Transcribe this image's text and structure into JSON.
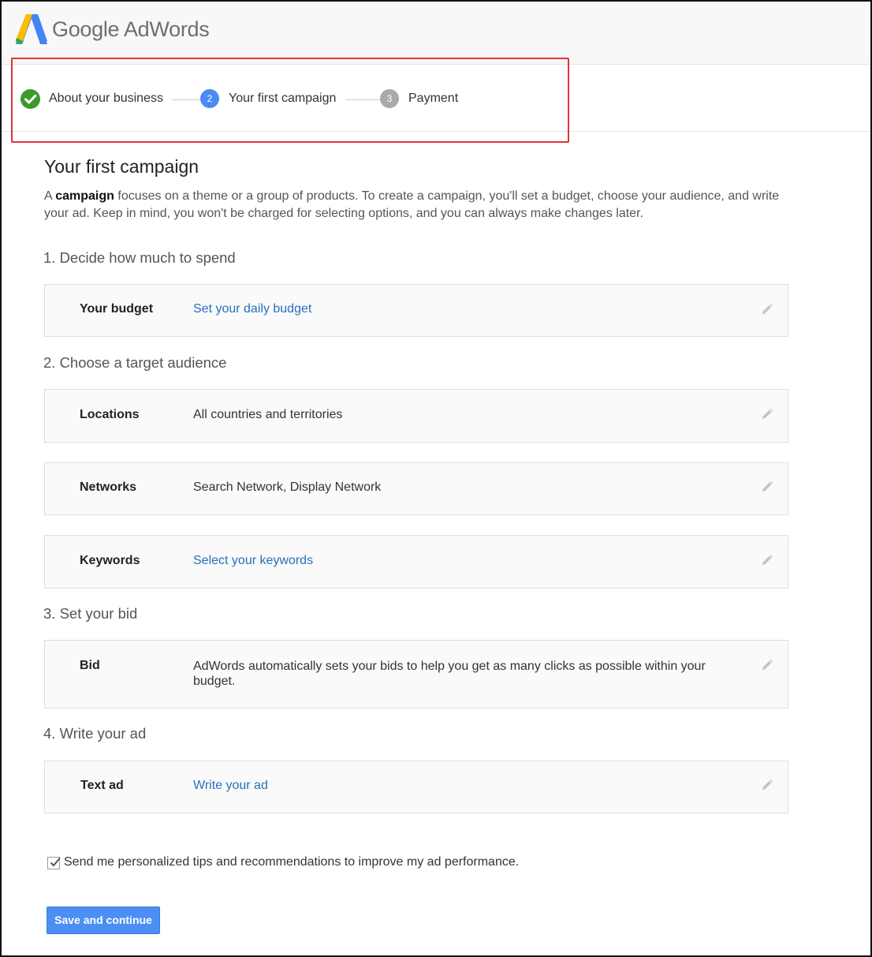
{
  "header": {
    "brand": "Google AdWords"
  },
  "stepper": {
    "steps": [
      {
        "label": "About your business",
        "marker": "",
        "status": "complete"
      },
      {
        "label": "Your first campaign",
        "marker": "2",
        "status": "current"
      },
      {
        "label": "Payment",
        "marker": "3",
        "status": "upcoming"
      }
    ]
  },
  "main": {
    "title": "Your first campaign",
    "intro_prefix": "A ",
    "intro_bold": "campaign",
    "intro_rest": " focuses on a theme or a group of products. To create a campaign, you'll set a budget, choose your audience, and write your ad. Keep in mind, you won't be charged for selecting options, and you can always make changes later.",
    "sections": [
      {
        "heading": "1. Decide how much to spend"
      },
      {
        "heading": "2. Choose a target audience"
      },
      {
        "heading": "3. Set your bid"
      },
      {
        "heading": "4. Write your ad"
      }
    ],
    "rows": {
      "budget": {
        "label": "Your budget",
        "value": "Set your daily budget"
      },
      "locations": {
        "label": "Locations",
        "value": "All countries and territories"
      },
      "networks": {
        "label": "Networks",
        "value": "Search Network, Display Network"
      },
      "keywords": {
        "label": "Keywords",
        "value": "Select your keywords"
      },
      "bid": {
        "label": "Bid",
        "value": "AdWords automatically sets your bids to help you get as many clicks as possible within your budget."
      },
      "text_ad": {
        "label": "Text ad",
        "value": "Write your ad"
      }
    }
  },
  "footer": {
    "tips_label": "Send me personalized tips and recommendations to improve my ad performance.",
    "tips_checked": true,
    "save_label": "Save and continue"
  },
  "colors": {
    "accent_blue": "#4a8af4",
    "link_blue": "#2a6ebd",
    "complete_green": "#3d9a2b",
    "highlight_red": "#e0343b"
  }
}
